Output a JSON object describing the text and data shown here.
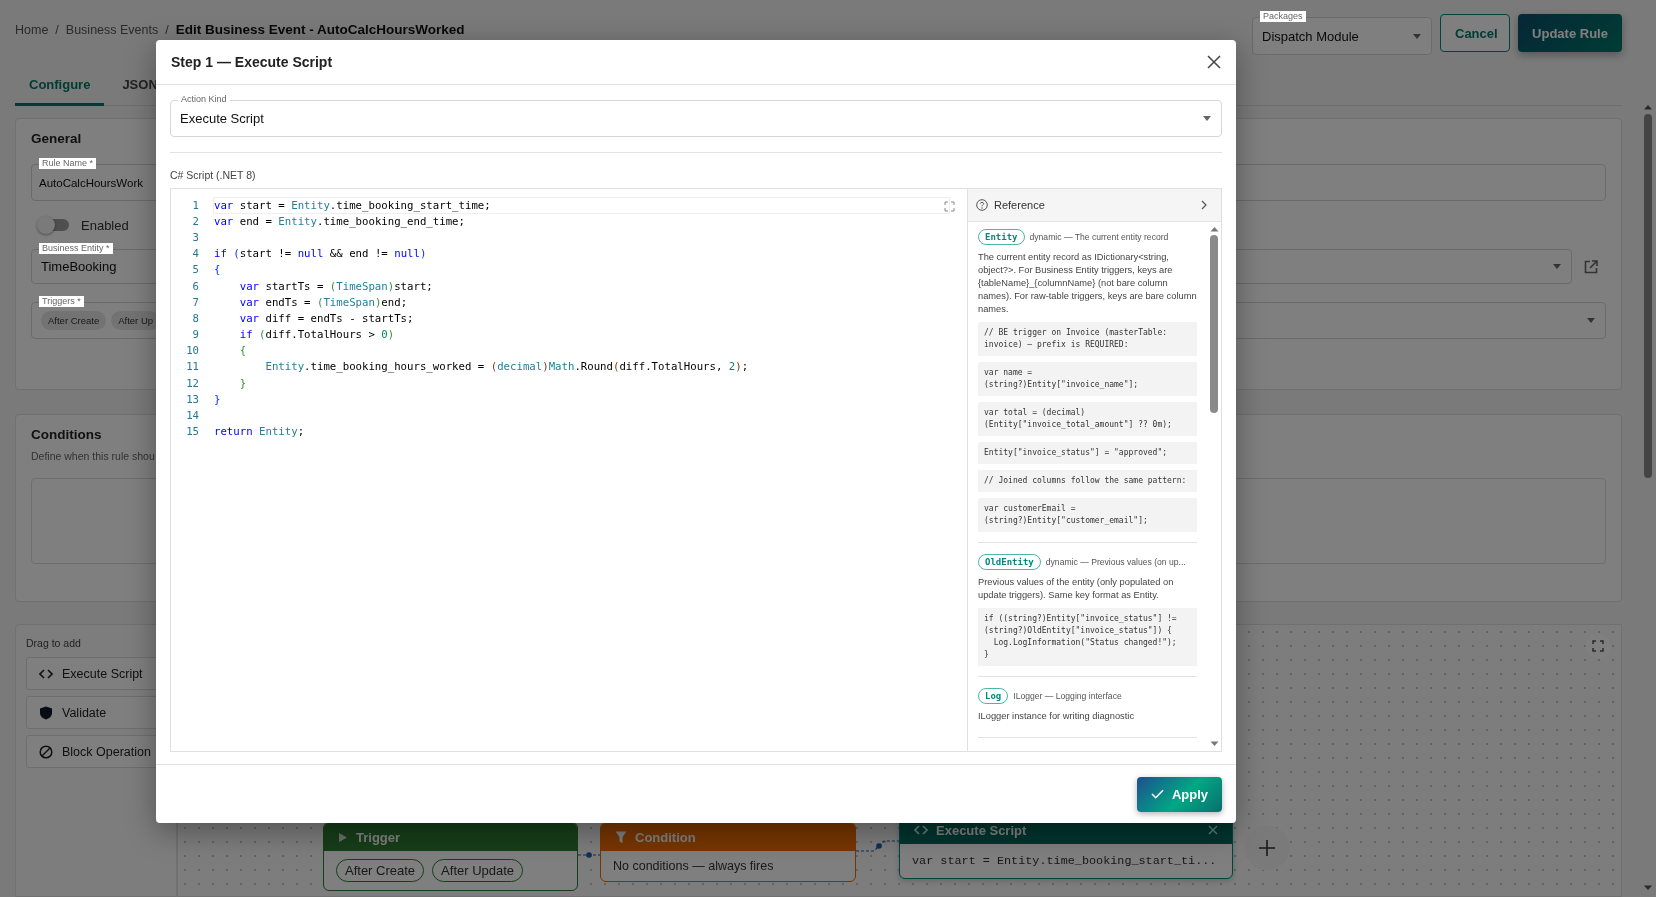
{
  "breadcrumb": [
    {
      "kind": "link",
      "text": "Home"
    },
    {
      "kind": "separator",
      "text": "/"
    },
    {
      "kind": "link",
      "text": "Business Events"
    },
    {
      "kind": "separator",
      "text": "/"
    },
    {
      "kind": "current",
      "text": "Edit Business Event - AutoCalcHoursWorked"
    }
  ],
  "packages": {
    "label": "Packages",
    "value": "Dispatch Module"
  },
  "header_buttons": [
    {
      "kind": "outlined",
      "label": "Cancel"
    },
    {
      "kind": "primary",
      "label": "Update Rule"
    }
  ],
  "tabs": [
    {
      "label": "Configure",
      "selected": true
    },
    {
      "label": "JSON",
      "selected": false
    }
  ],
  "general": {
    "title": "General",
    "rule_name": {
      "label": "Rule Name *",
      "value": "AutoCalcHoursWork"
    },
    "enabled": {
      "label": "Enabled",
      "on": false
    },
    "business_entity": {
      "label": "Business Entity *",
      "value": "TimeBooking"
    },
    "triggers": {
      "label": "Triggers *",
      "chips": [
        "After Create",
        "After Up"
      ]
    }
  },
  "conditions": {
    "title": "Conditions",
    "description": "Define when this rule shou"
  },
  "palette": {
    "title": "Drag to add",
    "items": [
      {
        "kind": "script",
        "label": "Execute Script"
      },
      {
        "kind": "validate",
        "label": "Validate"
      },
      {
        "kind": "block",
        "label": "Block Operation"
      }
    ]
  },
  "canvas": {
    "nodes": [
      {
        "kind": "trigger",
        "title": "Trigger",
        "chips": [
          "After Create",
          "After Update"
        ]
      },
      {
        "kind": "condition",
        "title": "Condition",
        "text": "No conditions — always fires"
      },
      {
        "kind": "script",
        "title": "Execute Script",
        "text": "var start = Entity.time_booking_start_ti..."
      }
    ]
  },
  "dialog": {
    "title": "Step 1 — Execute Script",
    "action_kind": {
      "label": "Action Kind",
      "value": "Execute Script"
    },
    "script_label": "C# Script (.NET 8)",
    "code_lines": [
      {
        "number": "1",
        "tokens": [
          {
            "kind": "keyword",
            "text": "var"
          },
          {
            "kind": "plain",
            "text": " start = "
          },
          {
            "kind": "type",
            "text": "Entity"
          },
          {
            "kind": "plain",
            "text": ".time_booking_start_time;"
          }
        ]
      },
      {
        "number": "2",
        "tokens": [
          {
            "kind": "keyword",
            "text": "var"
          },
          {
            "kind": "plain",
            "text": " end = "
          },
          {
            "kind": "type",
            "text": "Entity"
          },
          {
            "kind": "plain",
            "text": ".time_booking_end_time;"
          }
        ]
      },
      {
        "number": "3"
      },
      {
        "number": "4",
        "tokens": [
          {
            "kind": "keyword",
            "text": "if"
          },
          {
            "kind": "bracket1",
            "text": " ("
          },
          {
            "kind": "plain",
            "text": "start != "
          },
          {
            "kind": "keyword",
            "text": "null"
          },
          {
            "kind": "plain",
            "text": " && end != "
          },
          {
            "kind": "keyword",
            "text": "null"
          },
          {
            "kind": "bracket1",
            "text": ")"
          }
        ]
      },
      {
        "number": "5",
        "tokens": [
          {
            "kind": "bracket1",
            "text": "{"
          }
        ]
      },
      {
        "number": "6",
        "tokens": [
          {
            "kind": "keyword",
            "text": "    var"
          },
          {
            "kind": "plain",
            "text": " startTs = "
          },
          {
            "kind": "bracket2",
            "text": "("
          },
          {
            "kind": "type",
            "text": "TimeSpan"
          },
          {
            "kind": "bracket2",
            "text": ")"
          },
          {
            "kind": "plain",
            "text": "start;"
          }
        ]
      },
      {
        "number": "7",
        "tokens": [
          {
            "kind": "keyword",
            "text": "    var"
          },
          {
            "kind": "plain",
            "text": " endTs = "
          },
          {
            "kind": "bracket2",
            "text": "("
          },
          {
            "kind": "type",
            "text": "TimeSpan"
          },
          {
            "kind": "bracket2",
            "text": ")"
          },
          {
            "kind": "plain",
            "text": "end;"
          }
        ]
      },
      {
        "number": "8",
        "tokens": [
          {
            "kind": "keyword",
            "text": "    var"
          },
          {
            "kind": "plain",
            "text": " diff = endTs - startTs;"
          }
        ]
      },
      {
        "number": "9",
        "tokens": [
          {
            "kind": "keyword",
            "text": "    if"
          },
          {
            "kind": "bracket2",
            "text": " ("
          },
          {
            "kind": "plain",
            "text": "diff.TotalHours > "
          },
          {
            "kind": "number",
            "text": "0"
          },
          {
            "kind": "bracket2",
            "text": ")"
          }
        ]
      },
      {
        "number": "10",
        "tokens": [
          {
            "kind": "bracket2",
            "text": "    {"
          }
        ]
      },
      {
        "number": "11",
        "tokens": [
          {
            "kind": "type",
            "text": "        Entity"
          },
          {
            "kind": "plain",
            "text": ".time_booking_hours_worked = "
          },
          {
            "kind": "bracket3",
            "text": "("
          },
          {
            "kind": "type",
            "text": "decimal"
          },
          {
            "kind": "bracket3",
            "text": ")"
          },
          {
            "kind": "type",
            "text": "Math"
          },
          {
            "kind": "plain",
            "text": ".Round"
          },
          {
            "kind": "bracket3",
            "text": "("
          },
          {
            "kind": "plain",
            "text": "diff.TotalHours, "
          },
          {
            "kind": "number",
            "text": "2"
          },
          {
            "kind": "bracket3",
            "text": ")"
          },
          {
            "kind": "plain",
            "text": ";"
          }
        ]
      },
      {
        "number": "12",
        "tokens": [
          {
            "kind": "bracket2",
            "text": "    }"
          }
        ]
      },
      {
        "number": "13",
        "tokens": [
          {
            "kind": "bracket1",
            "text": "}"
          }
        ]
      },
      {
        "number": "14"
      },
      {
        "number": "15",
        "tokens": [
          {
            "kind": "keyword",
            "text": "return"
          },
          {
            "kind": "type",
            "text": " Entity"
          },
          {
            "kind": "plain",
            "text": ";"
          }
        ]
      }
    ],
    "reference": {
      "title": "Reference",
      "entries": [
        {
          "name": "Entity",
          "signature": "dynamic — The current entity record",
          "description": "The current entity record as IDictionary<string, object?>. For Business Entity triggers, keys are {tableName}_{columnName} (not bare column names). For raw-table triggers, keys are bare column names.",
          "examples": [
            "// BE trigger on Invoice (masterTable: invoice) — prefix is REQUIRED:",
            "var name = (string?)Entity[\"invoice_name\"];",
            "var total = (decimal)\n(Entity[\"invoice_total_amount\"] ?? 0m);",
            "Entity[\"invoice_status\"] = \"approved\";",
            "// Joined columns follow the same pattern:",
            "var customerEmail = (string?)Entity[\"customer_email\"];"
          ]
        },
        {
          "name": "OldEntity",
          "signature": "dynamic — Previous values (on up...",
          "description": "Previous values of the entity (only populated on update triggers). Same key format as Entity.",
          "examples": [
            "if ((string?)Entity[\"invoice_status\"] !=\n(string?)OldEntity[\"invoice_status\"]) {\n  Log.LogInformation(\"Status changed!\");\n}"
          ]
        },
        {
          "name": "Log",
          "signature": "ILogger — Logging interface",
          "description": "ILogger instance for writing diagnostic"
        }
      ]
    },
    "apply": "Apply"
  }
}
